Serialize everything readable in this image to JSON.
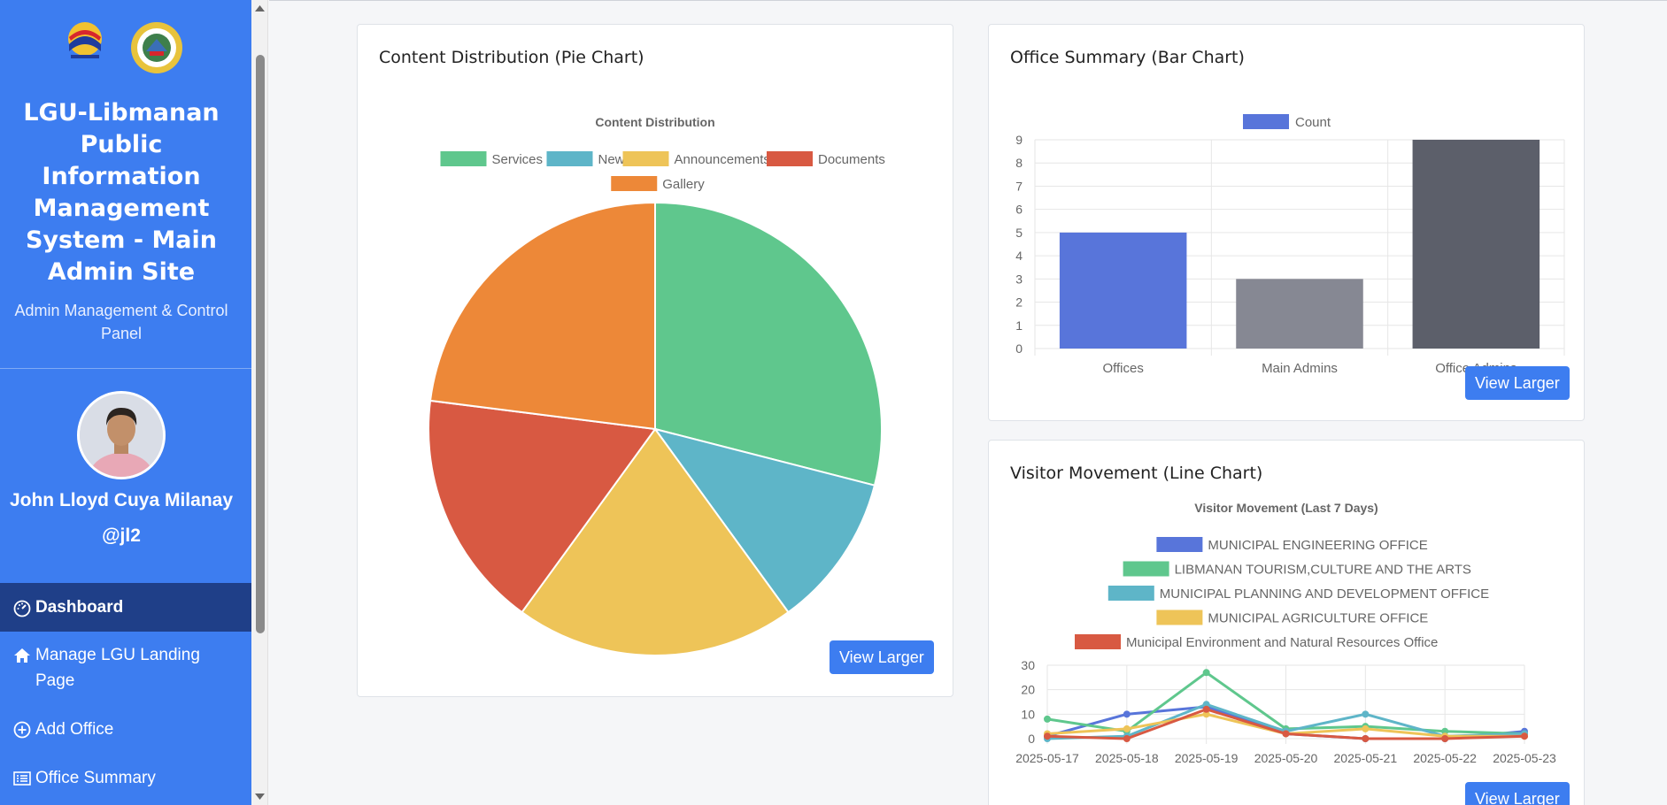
{
  "sidebar": {
    "title": "LGU-Libmanan Public Information Management System - Main Admin Site",
    "subtitle": "Admin Management & Control Panel",
    "user_name": "John Lloyd Cuya Milanay",
    "user_handle": "@jl2",
    "nav": [
      {
        "label": "Dashboard",
        "icon": "gauge-icon",
        "active": true
      },
      {
        "label": "Manage LGU Landing Page",
        "icon": "home-icon"
      },
      {
        "label": "Add Office",
        "icon": "plus-circle-icon"
      },
      {
        "label": "Office Summary",
        "icon": "list-icon"
      }
    ]
  },
  "cards": {
    "pie": {
      "title": "Content Distribution (Pie Chart)",
      "button": "View Larger"
    },
    "bar": {
      "title": "Office Summary (Bar Chart)",
      "button": "View Larger"
    },
    "line": {
      "title": "Visitor Movement (Line Chart)",
      "button": "View Larger"
    }
  },
  "chart_data": [
    {
      "type": "pie",
      "title": "Content Distribution",
      "categories": [
        "Services",
        "News",
        "Announcements",
        "Documents",
        "Gallery"
      ],
      "values": [
        29,
        11,
        20,
        17,
        23
      ],
      "colors": [
        "#5fc78d",
        "#5eb5c8",
        "#eec458",
        "#d85942",
        "#ed8838"
      ],
      "legend": "top"
    },
    {
      "type": "bar",
      "title": "",
      "series": [
        {
          "name": "Count",
          "values": [
            5,
            3,
            9
          ]
        }
      ],
      "categories": [
        "Offices",
        "Main Admins",
        "Office Admins"
      ],
      "colors": [
        "#5875da",
        "#868893",
        "#5c5f6a"
      ],
      "ylim": [
        0,
        9
      ],
      "yticks": [
        0,
        1,
        2,
        3,
        4,
        5,
        6,
        7,
        8,
        9
      ],
      "grid": true,
      "legend": "top"
    },
    {
      "type": "line",
      "title": "Visitor Movement (Last 7 Days)",
      "x": [
        "2025-05-17",
        "2025-05-18",
        "2025-05-19",
        "2025-05-20",
        "2025-05-21",
        "2025-05-22",
        "2025-05-23"
      ],
      "ylim": [
        0,
        30
      ],
      "yticks": [
        0,
        10,
        20,
        30
      ],
      "grid": true,
      "legend": "top",
      "series": [
        {
          "name": "MUNICIPAL ENGINEERING OFFICE",
          "color": "#5875da",
          "values": [
            1,
            10,
            13,
            2,
            0,
            0,
            3
          ]
        },
        {
          "name": "LIBMANAN TOURISM,CULTURE AND THE ARTS",
          "color": "#5fc78d",
          "values": [
            8,
            3,
            27,
            4,
            5,
            3,
            2
          ]
        },
        {
          "name": "MUNICIPAL PLANNING AND DEVELOPMENT OFFICE",
          "color": "#5eb5c8",
          "values": [
            0,
            1,
            14,
            3,
            10,
            1,
            2
          ]
        },
        {
          "name": "MUNICIPAL AGRICULTURE OFFICE",
          "color": "#eec458",
          "values": [
            2,
            4,
            10,
            2,
            4,
            1,
            1
          ]
        },
        {
          "name": "Municipal Environment and Natural Resources Office",
          "color": "#d85942",
          "values": [
            1,
            0,
            12,
            2,
            0,
            0,
            1
          ]
        }
      ]
    }
  ]
}
